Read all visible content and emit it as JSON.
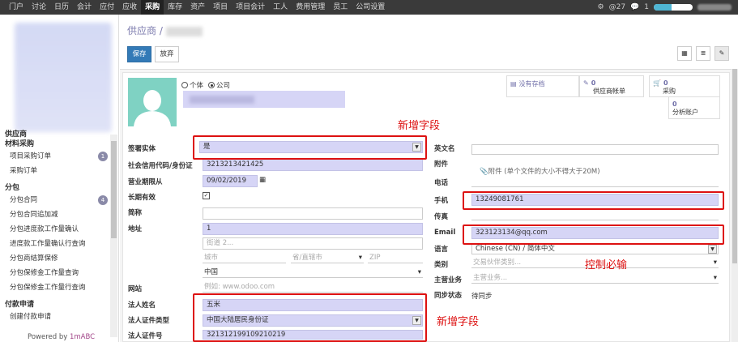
{
  "topbar": {
    "menu": [
      "门户",
      "讨论",
      "日历",
      "会计",
      "应付",
      "应收",
      "采购",
      "库存",
      "资产",
      "项目",
      "项目会计",
      "工人",
      "费用管理",
      "员工",
      "公司设置"
    ],
    "active": "采购",
    "gear": "⚙",
    "notif_count": "@27",
    "msg_count": "1"
  },
  "sidebar": {
    "sections": [
      {
        "title": "供应商",
        "items": []
      },
      {
        "title": "材料采购",
        "items": [
          {
            "label": "项目采购订单",
            "badge": "1"
          },
          {
            "label": "采购订单",
            "badge": ""
          }
        ]
      },
      {
        "title": "分包",
        "items": [
          {
            "label": "分包合同",
            "badge": "4"
          },
          {
            "label": "分包合同追加减",
            "badge": ""
          },
          {
            "label": "分包进度款工作量确认",
            "badge": ""
          },
          {
            "label": "进度款工作量确认行查询",
            "badge": ""
          },
          {
            "label": "分包商结算保修",
            "badge": ""
          },
          {
            "label": "分包保修金工作量查询",
            "badge": ""
          },
          {
            "label": "分包保修金工作量行查询",
            "badge": ""
          }
        ]
      },
      {
        "title": "付款申请",
        "items": [
          {
            "label": "创建付款申请",
            "badge": ""
          }
        ]
      }
    ],
    "powered_prefix": "Powered by ",
    "powered_brand": "1mABC"
  },
  "header": {
    "breadcrumb": "供应商",
    "sep": "/",
    "save": "保存",
    "discard": "放弃"
  },
  "form": {
    "type_individual": "个体",
    "type_company": "公司",
    "stats": [
      {
        "icon": "▤",
        "label": "没有存档",
        "value": ""
      },
      {
        "icon": "✎",
        "label": "供应商帐单",
        "value": "0"
      },
      {
        "icon": "🛒",
        "label": "采购",
        "value": "0"
      },
      {
        "icon": "▤",
        "label": "分析账户",
        "value": "0"
      }
    ],
    "left": {
      "sign_entity_label": "签署实体",
      "sign_entity_value": "是",
      "credit_code_label": "社会信用代码/身份证",
      "credit_code_value": "3213213421425",
      "period_label": "营业期限从",
      "period_value": "09/02/2019",
      "long_term_label": "长期有效",
      "long_term_checked": "✓",
      "short_name_label": "简称",
      "address_label": "地址",
      "street": "1",
      "street2_ph": "街道 2...",
      "city_ph": "城市",
      "state_ph": "省/直辖市",
      "zip_ph": "ZIP",
      "country": "中国",
      "website_label": "网站",
      "website_ph": "例如: www.odoo.com",
      "legal_name_label": "法人姓名",
      "legal_name_value": "五米",
      "legal_id_type_label": "法人证件类型",
      "legal_id_type_value": "中国大陆居民身份证",
      "legal_id_no_label": "法人证件号",
      "legal_id_no_value": "321312199109210219"
    },
    "right": {
      "en_name_label": "英文名",
      "attachment_label": "附件",
      "attachment_hint": "附件 (单个文件的大小不得大于20M)",
      "phone_label": "电话",
      "mobile_label": "手机",
      "mobile_value": "13249081761",
      "fax_label": "传真",
      "email_label": "Email",
      "email_value": "323123134@qq.com",
      "lang_label": "语言",
      "lang_value": "Chinese (CN) / 简体中文",
      "category_label": "类别",
      "category_ph": "交易伙伴类别...",
      "industry_label": "主营业务",
      "industry_ph": "主营业务...",
      "sync_label": "同步状态",
      "sync_value": "待同步"
    }
  },
  "annotations": {
    "new_field_1": "新增字段",
    "new_field_2": "新增字段",
    "required": "控制必输"
  },
  "colors": {
    "accent": "#7c7bad",
    "primary": "#337ab7",
    "annotation": "#dd1111",
    "required_bg": "#d6d5f6"
  }
}
